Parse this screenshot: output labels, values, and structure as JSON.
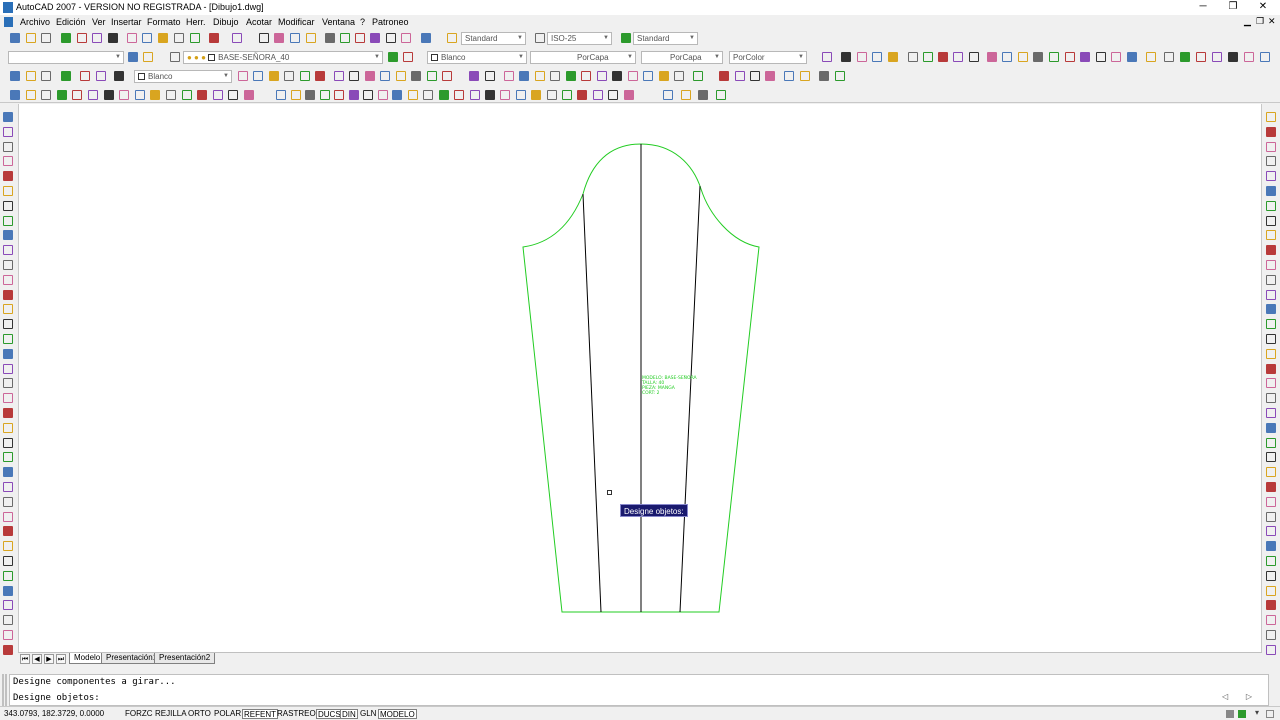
{
  "window": {
    "title": "AutoCAD 2007 - VERSION NO REGISTRADA - [Dibujo1.dwg]",
    "controls": [
      "─",
      "❐",
      "✕"
    ],
    "inner_controls": [
      "▁",
      "❐",
      "✕"
    ]
  },
  "menu": {
    "items": [
      "Archivo",
      "Edición",
      "Ver",
      "Insertar",
      "Formato",
      "Herr.",
      "Dibujo",
      "Acotar",
      "Modificar",
      "Ventana",
      "?",
      "Patroneo"
    ]
  },
  "styles_toolbar": {
    "text_style": "Standard",
    "dim_style": "ISO-25",
    "table_style": "Standard"
  },
  "layers_toolbar": {
    "layer": "BASE-SEÑORA_40",
    "color": "Blanco",
    "linetype": "PorCapa",
    "lineweight": "PorCapa",
    "plotstyle": "PorColor"
  },
  "standard_toolbar": {
    "color2": "Blanco"
  },
  "canvas": {
    "pattern_labels": [
      "MODELO: BASE-SEÑORA",
      "TALLA: 40",
      "PIEZA: MANGA",
      "CORT: 2"
    ],
    "tooltip": "Designe objetos:"
  },
  "layout_tabs": {
    "tabs": [
      "Modelo",
      "Presentación1",
      "Presentación2"
    ],
    "nav": [
      "⏮",
      "◀",
      "▶",
      "⏭"
    ]
  },
  "command": {
    "lines": [
      "Designe componentes a girar...",
      "Designe objetos:"
    ]
  },
  "status": {
    "coords": "343.0793, 182.3729, 0.0000",
    "toggles": [
      "FORZC",
      "REJILLA",
      "ORTO",
      "POLAR",
      "REFENT",
      "RASTREO",
      "DUCS",
      "DIN",
      "GLN",
      "MODELO"
    ]
  },
  "colors": {
    "pattern_outline": "#22cc22",
    "pattern_lines": "#000000",
    "tooltip_bg": "#1a1a6e"
  }
}
